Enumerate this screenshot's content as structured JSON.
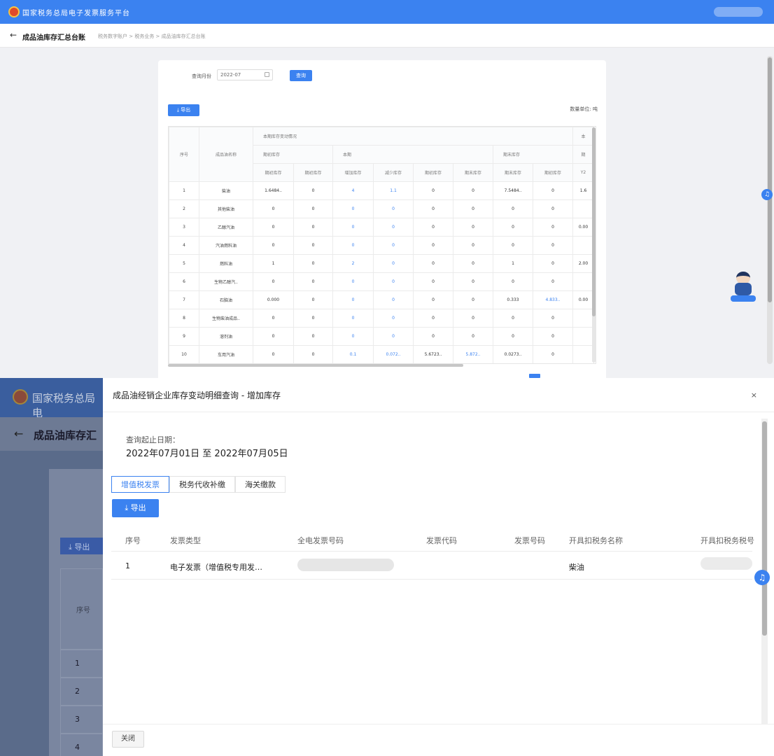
{
  "top": {
    "brand": "国家税务总局电子发票服务平台",
    "page_title": "成品油库存汇总台账",
    "breadcrumbs": "税务数字账户 > 税务业务 > 成品油库存汇总台账",
    "query_label": "查询月份",
    "query_value": "2022-07",
    "query_button": "查询",
    "export_button": "导出",
    "unit": "数量单位: 吨",
    "headers": {
      "seq": "序号",
      "name": "成品油名称",
      "group": "本期库存变动情况",
      "sub_a": "期初库存",
      "sub_b": "本期",
      "sub_c": "期末库存",
      "cols": [
        "期初库存",
        "期初库存",
        "增加库存",
        "减少库存",
        "期初库存",
        "期末库存",
        "期末库存",
        "期初库存",
        "Y2"
      ]
    },
    "rows": [
      {
        "n": "1",
        "name": "柴油",
        "v": [
          "1.6484..",
          "0",
          "4",
          "1.1",
          "0",
          "0",
          "7.5484..",
          "0",
          "1.6"
        ]
      },
      {
        "n": "2",
        "name": "其他柴油",
        "v": [
          "0",
          "0",
          "0",
          "0",
          "0",
          "0",
          "0",
          "0",
          ""
        ]
      },
      {
        "n": "3",
        "name": "乙醇汽油",
        "v": [
          "0",
          "0",
          "0",
          "0",
          "0",
          "0",
          "0",
          "0",
          "0.00"
        ]
      },
      {
        "n": "4",
        "name": "汽油燃料油",
        "v": [
          "0",
          "0",
          "0",
          "0",
          "0",
          "0",
          "0",
          "0",
          ""
        ]
      },
      {
        "n": "5",
        "name": "燃料油",
        "v": [
          "1",
          "0",
          "2",
          "0",
          "0",
          "0",
          "1",
          "0",
          "2.00"
        ]
      },
      {
        "n": "6",
        "name": "生物乙醇汽..",
        "v": [
          "0",
          "0",
          "0",
          "0",
          "0",
          "0",
          "0",
          "0",
          ""
        ]
      },
      {
        "n": "7",
        "name": "石脑油",
        "v": [
          "0.000",
          "0",
          "0",
          "0",
          "0",
          "0",
          "0.333",
          "4.833..",
          "0.00"
        ]
      },
      {
        "n": "8",
        "name": "生物柴油成品..",
        "v": [
          "0",
          "0",
          "0",
          "0",
          "0",
          "0",
          "0",
          "0",
          ""
        ]
      },
      {
        "n": "9",
        "name": "溶剂油",
        "v": [
          "0",
          "0",
          "0",
          "0",
          "0",
          "0",
          "0",
          "0",
          ""
        ]
      },
      {
        "n": "10",
        "name": "车用汽油",
        "v": [
          "0",
          "0",
          "0.1",
          "0.072..",
          "5.6723..",
          "5.872..",
          "0.0273..",
          "0",
          ""
        ]
      }
    ]
  },
  "bottom_bg": {
    "brand": "国家税务总局电",
    "title": "成品油库存汇",
    "export": "导出",
    "seq_header": "序号",
    "row_numbers": [
      "1",
      "2",
      "3",
      "4"
    ]
  },
  "modal": {
    "title": "成品油经销企业库存变动明细查询 - 增加库存",
    "close": "×",
    "date_label": "查询起止日期：",
    "date_range": "2022年07月01日 至 2022年07月05日",
    "tabs": [
      "增值税发票",
      "税务代收补缴",
      "海关缴款"
    ],
    "export": "导出",
    "columns": [
      "序号",
      "发票类型",
      "全电发票号码",
      "发票代码",
      "发票号码",
      "开具扣税务名称",
      "开具扣税务税号"
    ],
    "rows": [
      {
        "seq": "1",
        "type": "电子发票（增值税专用发…",
        "name": "柴油"
      }
    ],
    "footer_button": "关闭"
  }
}
